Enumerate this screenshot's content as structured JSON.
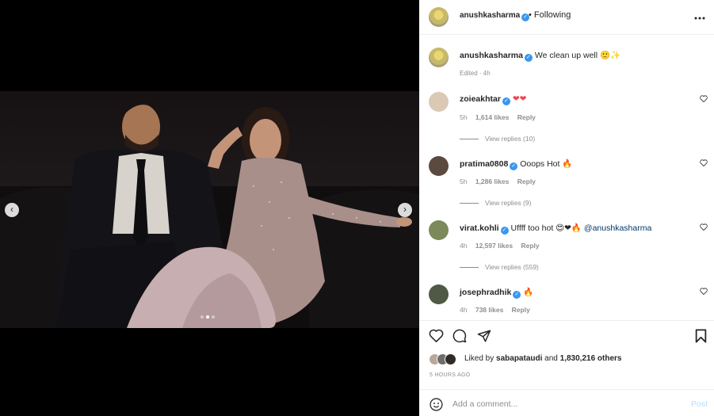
{
  "header": {
    "username": "anushkasharma",
    "separator": "•",
    "follow_status": "Following",
    "more_icon": "more-horizontal-icon"
  },
  "caption": {
    "username": "anushkasharma",
    "text": "We clean up well",
    "emojis": "🙂✨",
    "meta": "Edited · 4h"
  },
  "comments": [
    {
      "username": "zoieakhtar",
      "text": "",
      "emojis": "❤❤",
      "time": "5h",
      "likes": "1,614 likes",
      "reply": "Reply",
      "view_replies": "View replies (10)",
      "avatar_color": "#d9c9b5"
    },
    {
      "username": "pratima0808",
      "text": "Ooops Hot",
      "emojis": "🔥",
      "time": "5h",
      "likes": "1,286 likes",
      "reply": "Reply",
      "view_replies": "View replies (9)",
      "avatar_color": "#5b4a3f"
    },
    {
      "username": "virat.kohli",
      "text": "Uffff too hot",
      "emojis": "😍❤🔥",
      "mention": "@anushkasharma",
      "time": "4h",
      "likes": "12,597 likes",
      "reply": "Reply",
      "view_replies": "View replies (559)",
      "avatar_color": "#7a8a5a"
    },
    {
      "username": "josephradhik",
      "text": "",
      "emojis": "🔥",
      "time": "4h",
      "likes": "738 likes",
      "reply": "Reply",
      "view_replies": "",
      "avatar_color": "#4e5a45"
    }
  ],
  "likes": {
    "prefix": "Liked by",
    "user": "sabapataudi",
    "suffix": "and",
    "others": "1,830,216 others"
  },
  "post_time": "5 HOURS AGO",
  "add_comment": {
    "placeholder": "Add a comment...",
    "post_label": "Post"
  },
  "carousel": {
    "prev": "‹",
    "next": "›",
    "slide_count": 3,
    "active_index": 1
  },
  "colors": {
    "verified": "#3897f0",
    "mention": "#00376b",
    "post_disabled": "#b2dffc",
    "heart_red": "#ed4956"
  }
}
